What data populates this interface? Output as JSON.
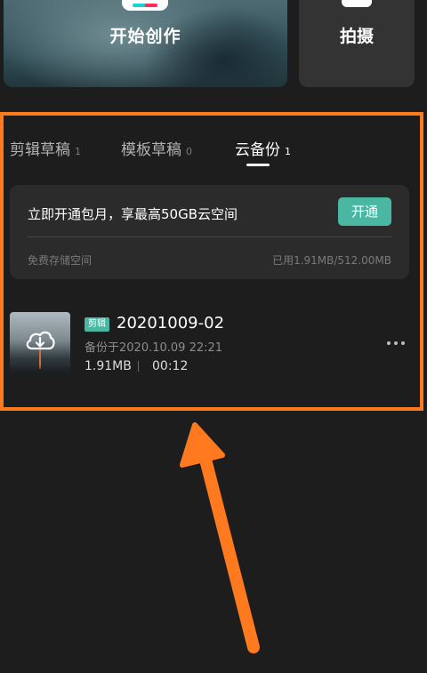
{
  "actions": {
    "start_create_label": "开始创作",
    "shoot_label": "拍摄"
  },
  "tabs": [
    {
      "label": "剪辑草稿",
      "count": "1"
    },
    {
      "label": "模板草稿",
      "count": "0"
    },
    {
      "label": "云备份",
      "count": "1"
    }
  ],
  "active_tab": "云备份",
  "promo": {
    "text": "立即开通包月，享最高50GB云空间",
    "button_label": "开通",
    "storage_label": "免费存储空间",
    "storage_usage": "已用1.91MB/512.00MB"
  },
  "draft": {
    "badge": "剪辑",
    "title": "20201009-02",
    "backup_time": "备份于2020.10.09 22:21",
    "size": "1.91MB",
    "duration": "00:12"
  },
  "colors": {
    "accent": "#4ab7a3",
    "highlight": "#ff7a1f",
    "background": "#1d1d1d"
  },
  "icons": [
    "cloud-download-icon",
    "more-icon",
    "pointer-arrow-icon"
  ]
}
